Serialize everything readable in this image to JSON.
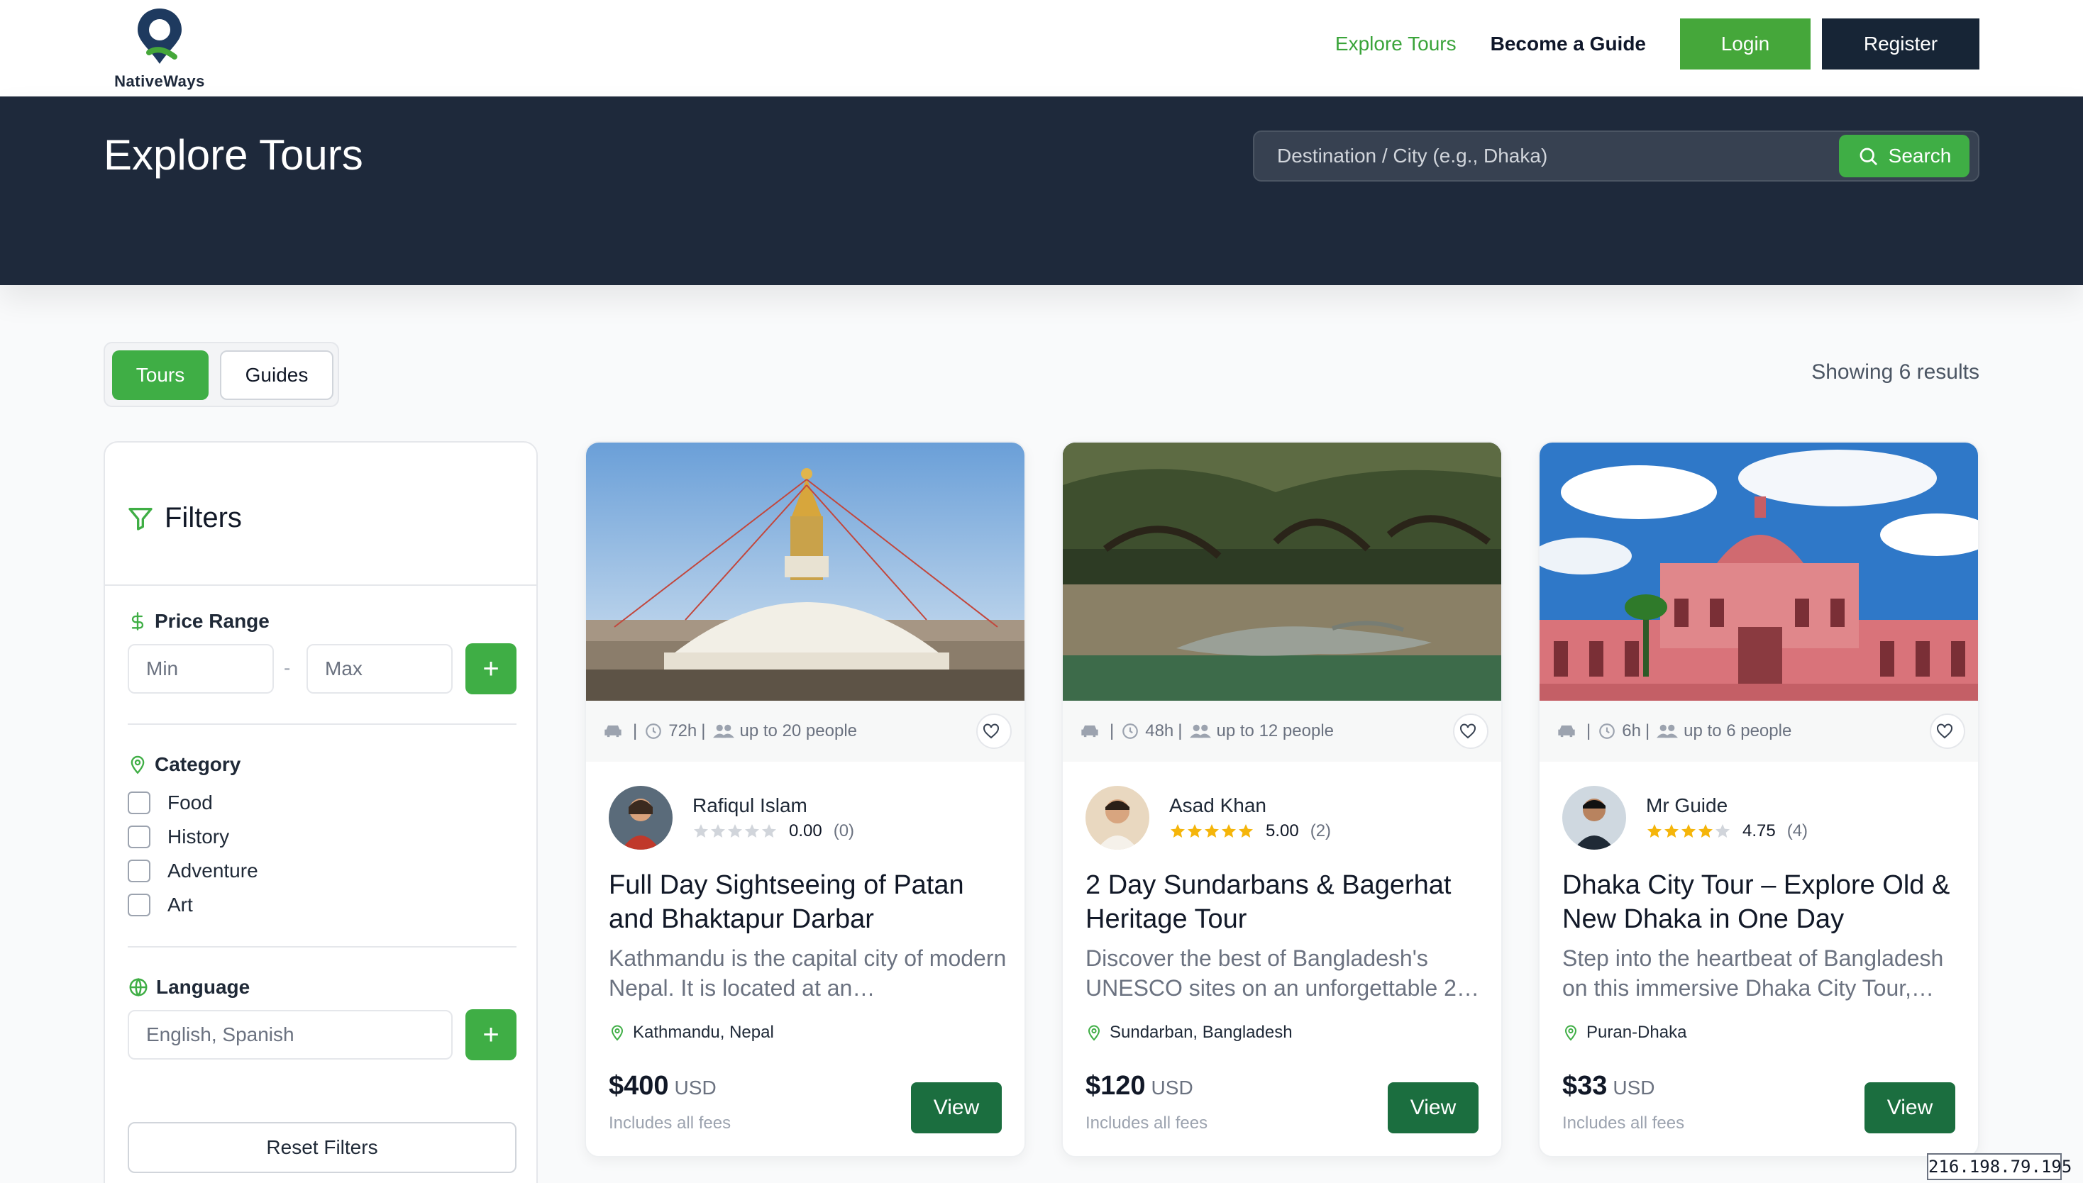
{
  "brand": {
    "name": "NativeWays"
  },
  "nav": {
    "explore": "Explore Tours",
    "become_guide": "Become a Guide",
    "login": "Login",
    "register": "Register"
  },
  "hero": {
    "title": "Explore Tours",
    "search_placeholder": "Destination / City (e.g., Dhaka)",
    "search_label": "Search"
  },
  "toggle": {
    "tours": "Tours",
    "guides": "Guides"
  },
  "results_text": "Showing 6 results",
  "filters": {
    "title": "Filters",
    "price_title": "Price Range",
    "min_placeholder": "Min",
    "max_placeholder": "Max",
    "separator": "-",
    "plus": "+",
    "category_title": "Category",
    "categories": [
      "Food",
      "History",
      "Adventure",
      "Art"
    ],
    "language_title": "Language",
    "language_placeholder": "English, Spanish",
    "reset": "Reset Filters"
  },
  "tours": [
    {
      "duration": "72h",
      "capacity": "up to 20 people",
      "guide": "Rafiqul Islam",
      "rating": "0.00",
      "reviews": "(0)",
      "stars_filled": 0,
      "title": "Full Day Sightseeing of Patan and Bhaktapur Darbar",
      "desc": "Kathmandu is the capital city of modern Nepal. It is located at an…",
      "location": "Kathmandu, Nepal",
      "price": "$400",
      "currency": "USD",
      "fees": "Includes all fees",
      "view": "View"
    },
    {
      "duration": "48h",
      "capacity": "up to 12 people",
      "guide": "Asad Khan",
      "rating": "5.00",
      "reviews": "(2)",
      "stars_filled": 5,
      "title": "2 Day Sundarbans & Bagerhat Heritage Tour",
      "desc": "Discover the best of Bangladesh's UNESCO sites on an unforgettable 2…",
      "location": "Sundarban, Bangladesh",
      "price": "$120",
      "currency": "USD",
      "fees": "Includes all fees",
      "view": "View"
    },
    {
      "duration": "6h",
      "capacity": "up to 6 people",
      "guide": "Mr Guide",
      "rating": "4.75",
      "reviews": "(4)",
      "stars_filled": 4,
      "title": "Dhaka City Tour – Explore Old & New Dhaka in One Day",
      "desc": "Step into the heartbeat of Bangladesh on this immersive Dhaka City Tour,…",
      "location": "Puran-Dhaka",
      "price": "$33",
      "currency": "USD",
      "fees": "Includes all fees",
      "view": "View"
    }
  ],
  "ip_address": "216.198.79.195",
  "colors": {
    "accent": "#3fae45",
    "dark": "#1e293b",
    "view_button": "#1b6e3f"
  },
  "icons": [
    "logo-pin-icon",
    "search-icon",
    "filter-icon",
    "dollar-icon",
    "map-pin-icon",
    "globe-icon",
    "car-icon",
    "clock-icon",
    "users-icon",
    "heart-icon",
    "star-icon"
  ]
}
